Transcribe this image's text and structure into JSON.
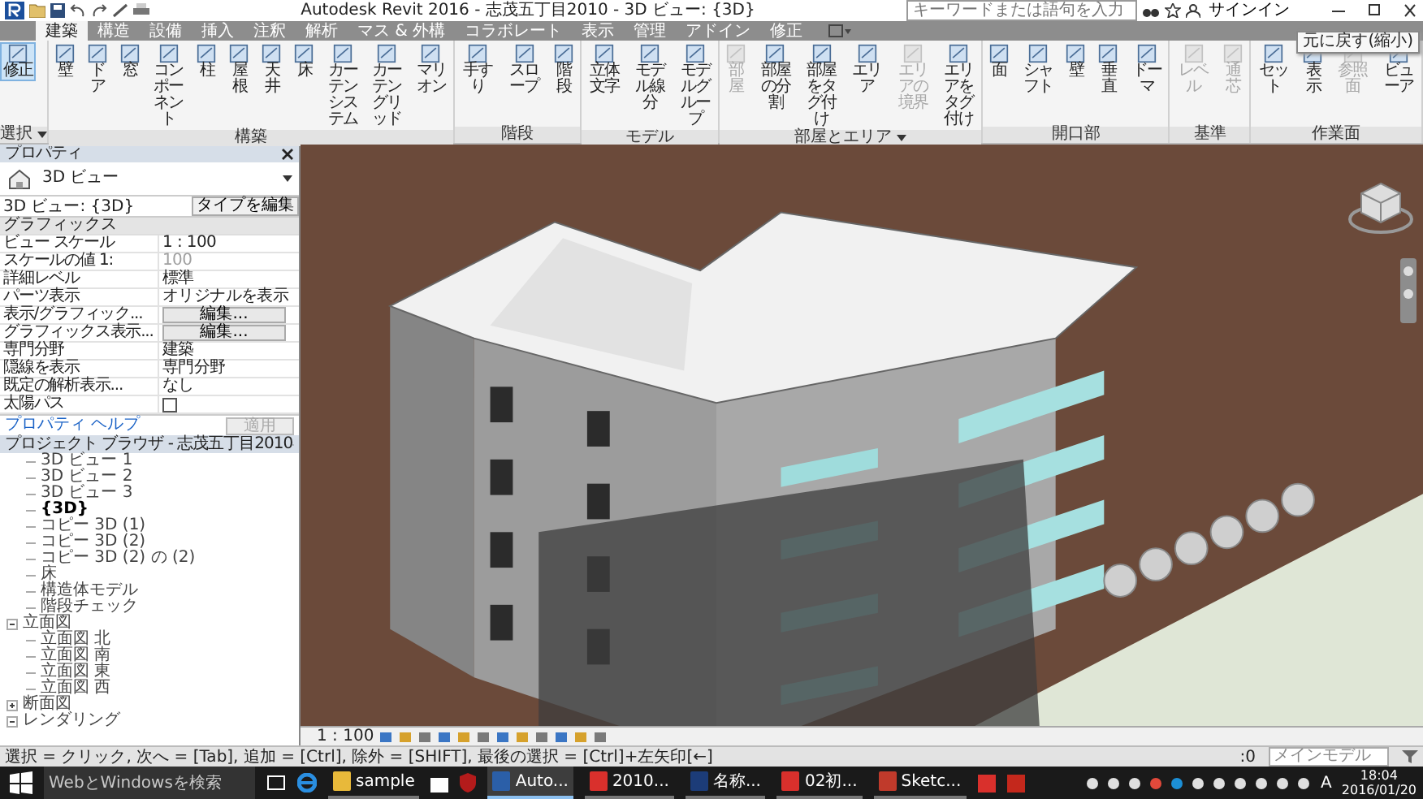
{
  "title_bar": {
    "title": "Autodesk Revit 2016 -   志茂五丁目2010 - 3D ビュー: {3D}",
    "search": {
      "placeholder": "キーワードまたは語句を入力"
    },
    "sign_in": "サインイン"
  },
  "ribbon_tabs": [
    {
      "label": "建築",
      "selected": true
    },
    {
      "label": "構造",
      "selected": false
    },
    {
      "label": "設備",
      "selected": false
    },
    {
      "label": "挿入",
      "selected": false
    },
    {
      "label": "注釈",
      "selected": false
    },
    {
      "label": "解析",
      "selected": false
    },
    {
      "label": "マス & 外構",
      "selected": false
    },
    {
      "label": "コラボレート",
      "selected": false
    },
    {
      "label": "表示",
      "selected": false
    },
    {
      "label": "管理",
      "selected": false
    },
    {
      "label": "アドイン",
      "selected": false
    },
    {
      "label": "修正",
      "selected": false
    }
  ],
  "ribbon_groups": [
    {
      "label": "選択",
      "dropdown": true,
      "tools": [
        {
          "label": "修正",
          "selected": true,
          "disabled": false
        }
      ]
    },
    {
      "label": "構築",
      "dropdown": false,
      "tools": [
        {
          "label": "壁",
          "selected": false,
          "disabled": false
        },
        {
          "label": "ドア",
          "selected": false,
          "disabled": false
        },
        {
          "label": "窓",
          "selected": false,
          "disabled": false
        },
        {
          "label": "コンポーネント",
          "selected": false,
          "disabled": false
        },
        {
          "label": "柱",
          "selected": false,
          "disabled": false
        },
        {
          "label": "屋根",
          "selected": false,
          "disabled": false
        },
        {
          "label": "天井",
          "selected": false,
          "disabled": false
        },
        {
          "label": "床",
          "selected": false,
          "disabled": false
        },
        {
          "label": "カーテンシステム",
          "selected": false,
          "disabled": false
        },
        {
          "label": "カーテングリッド",
          "selected": false,
          "disabled": false
        },
        {
          "label": "マリオン",
          "selected": false,
          "disabled": false
        }
      ]
    },
    {
      "label": "階段",
      "dropdown": false,
      "tools": [
        {
          "label": "手すり",
          "selected": false,
          "disabled": false
        },
        {
          "label": "スロープ",
          "selected": false,
          "disabled": false
        },
        {
          "label": "階段",
          "selected": false,
          "disabled": false
        }
      ]
    },
    {
      "label": "モデル",
      "dropdown": false,
      "tools": [
        {
          "label": "立体文字",
          "selected": false,
          "disabled": false
        },
        {
          "label": "モデル線分",
          "selected": false,
          "disabled": false
        },
        {
          "label": "モデルグループ",
          "selected": false,
          "disabled": false
        }
      ]
    },
    {
      "label": "部屋とエリア",
      "dropdown": true,
      "tools": [
        {
          "label": "部屋",
          "selected": false,
          "disabled": true
        },
        {
          "label": "部屋の分割",
          "selected": false,
          "disabled": false
        },
        {
          "label": "部屋をタグ付け",
          "selected": false,
          "disabled": false
        },
        {
          "label": "エリア",
          "selected": false,
          "disabled": false
        },
        {
          "label": "エリアの境界",
          "selected": false,
          "disabled": true
        },
        {
          "label": "エリアをタグ付け",
          "selected": false,
          "disabled": false
        }
      ]
    },
    {
      "label": "開口部",
      "dropdown": false,
      "tools": [
        {
          "label": "面",
          "selected": false,
          "disabled": false
        },
        {
          "label": "シャフト",
          "selected": false,
          "disabled": false
        },
        {
          "label": "壁",
          "selected": false,
          "disabled": false
        },
        {
          "label": "垂直",
          "selected": false,
          "disabled": false
        },
        {
          "label": "ドーマ",
          "selected": false,
          "disabled": false
        }
      ]
    },
    {
      "label": "基準",
      "dropdown": false,
      "tools": [
        {
          "label": "レベル",
          "selected": false,
          "disabled": true
        },
        {
          "label": "通芯",
          "selected": false,
          "disabled": true
        }
      ]
    },
    {
      "label": "作業面",
      "dropdown": false,
      "tools": [
        {
          "label": "セット",
          "selected": false,
          "disabled": false
        },
        {
          "label": "表示",
          "selected": false,
          "disabled": false
        },
        {
          "label": "参照面",
          "selected": false,
          "disabled": true
        },
        {
          "label": "ビューア",
          "selected": false,
          "disabled": false
        }
      ]
    }
  ],
  "tooltip": "元に戻す(縮小)",
  "properties": {
    "title": "プロパティ",
    "type_name": "3D ビュー",
    "instance": "3D ビュー: {3D}",
    "edit_type": "タイプを編集",
    "section": "グラフィックス",
    "rows": [
      {
        "kind": "text",
        "name": "ビュー スケール",
        "value": "1 : 100",
        "disabled": false
      },
      {
        "kind": "text",
        "name": "スケールの値  1:",
        "value": "100",
        "disabled": true
      },
      {
        "kind": "text",
        "name": "詳細レベル",
        "value": "標準",
        "disabled": false
      },
      {
        "kind": "text",
        "name": "パーツ表示",
        "value": "オリジナルを表示",
        "disabled": false
      },
      {
        "kind": "button",
        "name": "表示/グラフィック...",
        "value": "編集...",
        "disabled": false
      },
      {
        "kind": "button",
        "name": "グラフィックス表示...",
        "value": "編集...",
        "disabled": false
      },
      {
        "kind": "text",
        "name": "専門分野",
        "value": "建築",
        "disabled": false
      },
      {
        "kind": "text",
        "name": "隠線を表示",
        "value": "専門分野",
        "disabled": false
      },
      {
        "kind": "text",
        "name": "既定の解析表示...",
        "value": "なし",
        "disabled": false
      },
      {
        "kind": "checkbox",
        "name": "太陽パス",
        "checked": false,
        "disabled": false
      }
    ],
    "help": "プロパティ ヘルプ",
    "apply": {
      "label": "適用",
      "disabled": true
    }
  },
  "project_browser": {
    "title": "プロジェクト ブラウザ - 志茂五丁目2010",
    "tree": [
      {
        "children": [
          {
            "label": "3D ビュー 1",
            "selected": false
          },
          {
            "label": "3D ビュー 2",
            "selected": false
          },
          {
            "label": "3D ビュー 3",
            "selected": false
          },
          {
            "label": "{3D}",
            "selected": true
          },
          {
            "label": "コピー 3D (1)",
            "selected": false
          },
          {
            "label": "コピー 3D (2)",
            "selected": false
          },
          {
            "label": "コピー 3D (2) の (2)",
            "selected": false
          },
          {
            "label": "床",
            "selected": false
          },
          {
            "label": "構造体モデル",
            "selected": false
          },
          {
            "label": "階段チェック",
            "selected": false
          }
        ]
      },
      {
        "label": "立面図",
        "expanded": true,
        "children": [
          {
            "label": "立面図 北",
            "selected": false
          },
          {
            "label": "立面図 南",
            "selected": false
          },
          {
            "label": "立面図 東",
            "selected": false
          },
          {
            "label": "立面図 西",
            "selected": false
          }
        ]
      },
      {
        "label": "断面図",
        "expanded": false
      },
      {
        "label": "レンダリング",
        "expanded": true
      }
    ]
  },
  "view_bar": {
    "scale": "1 : 100"
  },
  "status_bar": {
    "hint": "選択 = クリック, 次へ = [Tab], 追加 = [Ctrl], 除外 = [SHIFT], 最後の選択 = [Ctrl]+左矢印[←]",
    "counter": ":0",
    "model": "メインモデル"
  },
  "taskbar": {
    "search": {
      "placeholder": "WebとWindowsを検索"
    },
    "apps": [
      {
        "kind": "folder",
        "label": "sample",
        "selected": false
      },
      {
        "kind": "revit",
        "label": "Auto...",
        "selected": true
      },
      {
        "kind": "pdf",
        "label": "2010...",
        "selected": false
      },
      {
        "kind": "photoshop",
        "label": "名称...",
        "selected": false
      },
      {
        "kind": "pdf",
        "label": "02初...",
        "selected": false
      },
      {
        "kind": "sketchup",
        "label": "Sketc...",
        "selected": false
      }
    ],
    "ime": "A",
    "time": "18:04",
    "date": "2016/01/20"
  }
}
